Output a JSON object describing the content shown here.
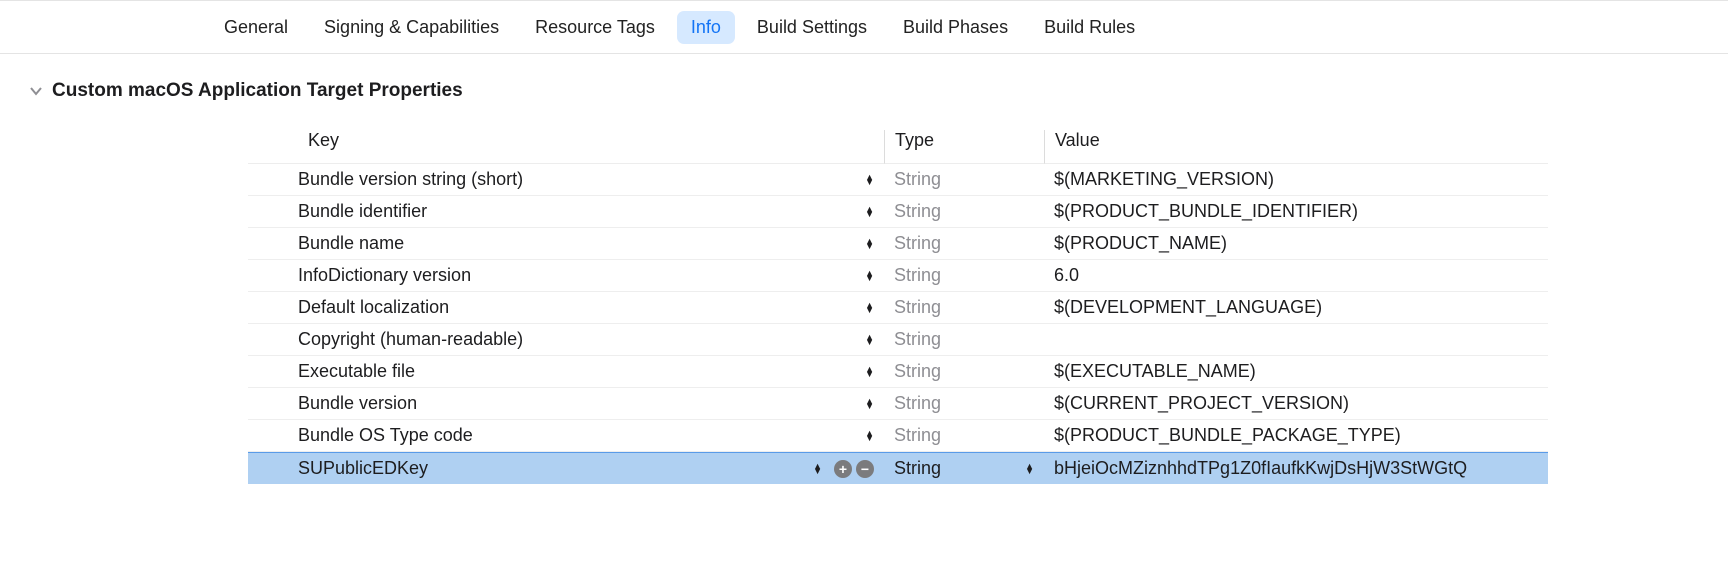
{
  "tabs": [
    {
      "label": "General",
      "selected": false
    },
    {
      "label": "Signing & Capabilities",
      "selected": false
    },
    {
      "label": "Resource Tags",
      "selected": false
    },
    {
      "label": "Info",
      "selected": true
    },
    {
      "label": "Build Settings",
      "selected": false
    },
    {
      "label": "Build Phases",
      "selected": false
    },
    {
      "label": "Build Rules",
      "selected": false
    }
  ],
  "section": {
    "title": "Custom macOS Application Target Properties"
  },
  "columns": {
    "key": "Key",
    "type": "Type",
    "value": "Value"
  },
  "rows": [
    {
      "key": "Bundle version string (short)",
      "type": "String",
      "value": "$(MARKETING_VERSION)",
      "selected": false
    },
    {
      "key": "Bundle identifier",
      "type": "String",
      "value": "$(PRODUCT_BUNDLE_IDENTIFIER)",
      "selected": false
    },
    {
      "key": "Bundle name",
      "type": "String",
      "value": "$(PRODUCT_NAME)",
      "selected": false
    },
    {
      "key": "InfoDictionary version",
      "type": "String",
      "value": "6.0",
      "selected": false
    },
    {
      "key": "Default localization",
      "type": "String",
      "value": "$(DEVELOPMENT_LANGUAGE)",
      "selected": false
    },
    {
      "key": "Copyright (human-readable)",
      "type": "String",
      "value": "",
      "selected": false
    },
    {
      "key": "Executable file",
      "type": "String",
      "value": "$(EXECUTABLE_NAME)",
      "selected": false
    },
    {
      "key": "Bundle version",
      "type": "String",
      "value": "$(CURRENT_PROJECT_VERSION)",
      "selected": false
    },
    {
      "key": "Bundle OS Type code",
      "type": "String",
      "value": "$(PRODUCT_BUNDLE_PACKAGE_TYPE)",
      "selected": false
    },
    {
      "key": "SUPublicEDKey",
      "type": "String",
      "value": "bHjeiOcMZiznhhdTPg1Z0fIaufkKwjDsHjW3StWGtQ",
      "selected": true
    }
  ]
}
